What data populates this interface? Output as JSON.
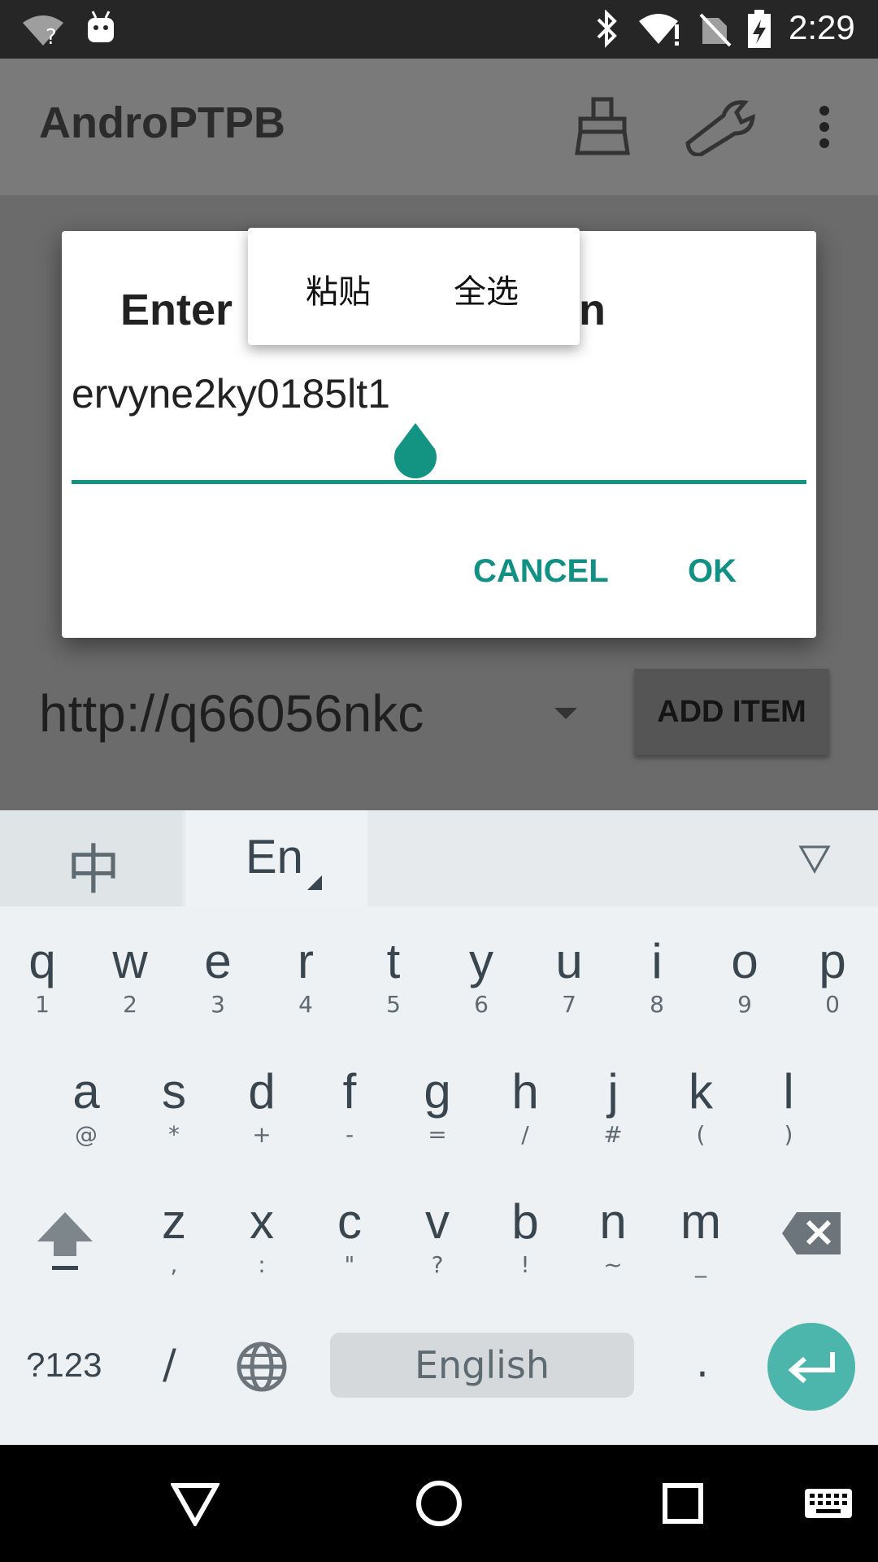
{
  "status_bar": {
    "time": "2:29",
    "icons": [
      "wifi-question-icon",
      "android-debug-icon",
      "bluetooth-icon",
      "wifi-alert-icon",
      "no-sim-icon",
      "battery-charging-icon"
    ]
  },
  "app_bar": {
    "title": "AndroPTPB",
    "actions": [
      "clear-brush-icon",
      "wrench-icon",
      "overflow-menu-icon"
    ]
  },
  "main": {
    "url_value": "http://q66056nkc",
    "add_item_label": "ADD ITEM"
  },
  "dialog": {
    "title_left": "Enter",
    "title_right": "n",
    "input_value": "ervyne2ky0185lt1",
    "cancel_label": "CANCEL",
    "ok_label": "OK"
  },
  "popup": {
    "paste_label": "粘贴",
    "select_all_label": "全选"
  },
  "keyboard": {
    "tab_zh": "中",
    "tab_en": "En",
    "row1": [
      {
        "k": "q",
        "s": "1"
      },
      {
        "k": "w",
        "s": "2"
      },
      {
        "k": "e",
        "s": "3"
      },
      {
        "k": "r",
        "s": "4"
      },
      {
        "k": "t",
        "s": "5"
      },
      {
        "k": "y",
        "s": "6"
      },
      {
        "k": "u",
        "s": "7"
      },
      {
        "k": "i",
        "s": "8"
      },
      {
        "k": "o",
        "s": "9"
      },
      {
        "k": "p",
        "s": "0"
      }
    ],
    "row2": [
      {
        "k": "a",
        "s": "@"
      },
      {
        "k": "s",
        "s": "*"
      },
      {
        "k": "d",
        "s": "+"
      },
      {
        "k": "f",
        "s": "-"
      },
      {
        "k": "g",
        "s": "="
      },
      {
        "k": "h",
        "s": "/"
      },
      {
        "k": "j",
        "s": "#"
      },
      {
        "k": "k",
        "s": "("
      },
      {
        "k": "l",
        "s": ")"
      }
    ],
    "row3": [
      {
        "k": "z",
        "s": ","
      },
      {
        "k": "x",
        "s": ":"
      },
      {
        "k": "c",
        "s": "\""
      },
      {
        "k": "v",
        "s": "?"
      },
      {
        "k": "b",
        "s": "!"
      },
      {
        "k": "n",
        "s": "~"
      },
      {
        "k": "m",
        "s": "_"
      }
    ],
    "symbols_label": "?123",
    "slash_label": "/",
    "space_label": "English",
    "period_label": ".",
    "colors": {
      "accent": "#4db6ac",
      "text": "#39464f"
    }
  },
  "nav_bar": {
    "icons": [
      "back-icon",
      "home-icon",
      "recents-icon",
      "keyboard-icon"
    ]
  }
}
